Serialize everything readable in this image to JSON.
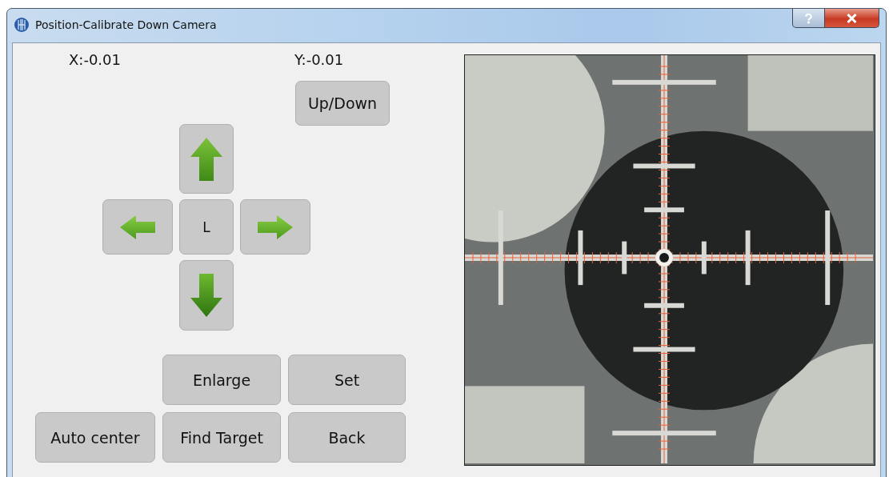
{
  "window": {
    "title": "Position-Calibrate Down Camera"
  },
  "readouts": {
    "x": "X:-0.01",
    "y": "Y:-0.01"
  },
  "mode_button": "Up/Down",
  "jog_pad": {
    "center_label": "L"
  },
  "action_buttons": {
    "enlarge": "Enlarge",
    "set": "Set",
    "auto_center": "Auto center",
    "find_target": "Find Target",
    "back": "Back"
  }
}
